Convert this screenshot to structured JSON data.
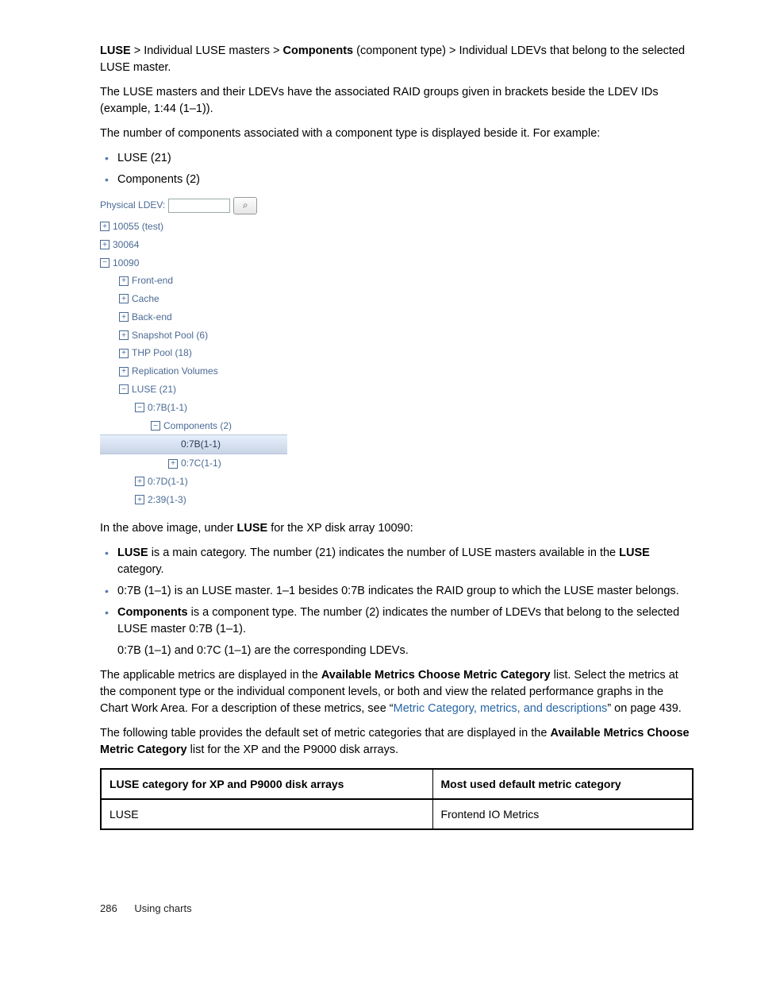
{
  "breadcrumb": {
    "luse": "LUSE",
    "sep1": " > Individual LUSE masters > ",
    "components": "Components",
    "tail": " (component type) > Individual LDEVs that belong to the selected LUSE master."
  },
  "para_raid": "The LUSE masters and their LDEVs have the associated RAID groups given in brackets beside the LDEV IDs (example, 1:44 (1–1)).",
  "para_count": "The number of components associated with a component type is displayed beside it. For example:",
  "top_bullets": [
    "LUSE (21)",
    "Components (2)"
  ],
  "tree": {
    "label": "Physical LDEV:",
    "search_placeholder": "",
    "search_icon": "⌕",
    "items": {
      "n10055": "10055 (test)",
      "n30064": "30064",
      "n10090": "10090",
      "frontend": "Front-end",
      "cache": "Cache",
      "backend": "Back-end",
      "snapshot": "Snapshot Pool (6)",
      "thp": "THP Pool (18)",
      "repl": "Replication Volumes",
      "luse": "LUSE (21)",
      "l07b": "0:7B(1-1)",
      "components": "Components (2)",
      "sel": "0:7B(1-1)",
      "l07c": "0:7C(1-1)",
      "l07d": "0:7D(1-1)",
      "l239": "2:39(1-3)"
    }
  },
  "para_above": {
    "pre": "In the above image, under ",
    "bold": "LUSE",
    "post": " for the XP disk array 10090:"
  },
  "desc_bullets": {
    "b1": {
      "bold": "LUSE",
      "txt1": " is a main category. The number (21) indicates the number of LUSE masters available in the ",
      "bold2": "LUSE",
      "txt2": " category."
    },
    "b2": "0:7B (1–1) is an LUSE master. 1–1 besides 0:7B indicates the RAID group to which the LUSE master belongs.",
    "b3": {
      "bold": "Components",
      "txt": " is a component type. The number (2) indicates the number of LDEVs that belong to the selected LUSE master 0:7B (1–1)."
    },
    "b3_sub": "0:7B (1–1) and 0:7C (1–1) are the corresponding LDEVs."
  },
  "para_metrics": {
    "p1": "The applicable metrics are displayed in the ",
    "b1": "Available Metrics Choose Metric Category",
    "p2": " list. Select the metrics at the component type or the individual component levels, or both and view the related performance graphs in the Chart Work Area. For a description of these metrics, see “",
    "link": "Metric Category, metrics, and descriptions",
    "p3": "” on page 439."
  },
  "para_table": {
    "p1": "The following table provides the default set of metric categories that are displayed in the ",
    "b1": "Available Metrics Choose Metric Category",
    "p2": " list for the XP and the P9000 disk arrays."
  },
  "table": {
    "h1": "LUSE category for XP and P9000 disk arrays",
    "h2": "Most used default metric category",
    "r1c1": "LUSE",
    "r1c2": "Frontend IO Metrics"
  },
  "footer": {
    "page": "286",
    "chapter": "Using charts"
  }
}
